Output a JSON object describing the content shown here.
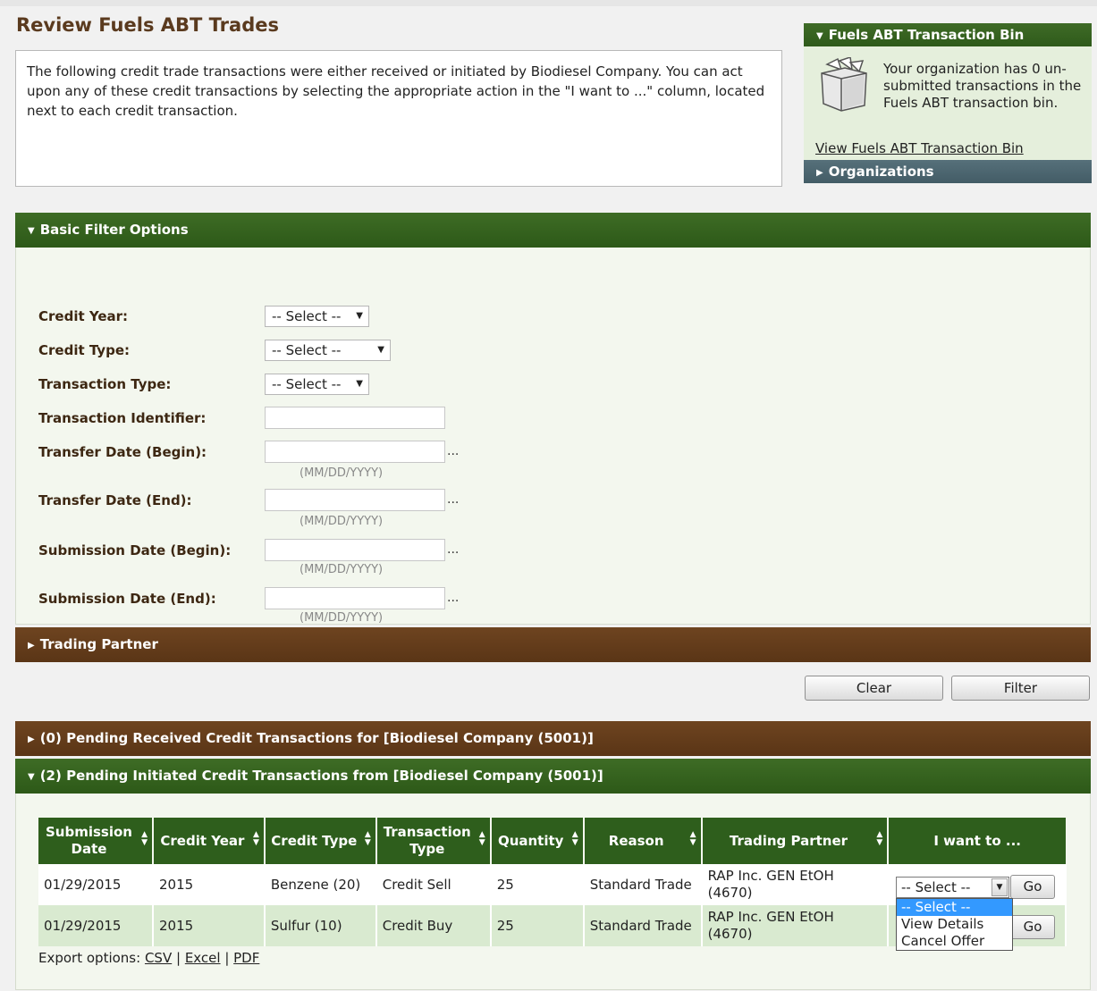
{
  "page": {
    "title": "Review Fuels ABT Trades",
    "intro": "The following credit trade transactions were either received or initiated by Biodiesel Company. You can act upon any of these credit transactions by selecting the appropriate action in the \"I want to ...\" column, located next to each credit transaction."
  },
  "sidebar": {
    "bin_title": "Fuels ABT Transaction Bin",
    "bin_message": "Your organization has 0 un-submitted transactions in the Fuels ABT transaction bin.",
    "bin_link": "View Fuels ABT Transaction Bin",
    "organizations_title": "Organizations"
  },
  "filters": {
    "title": "Basic Filter Options",
    "credit_year_label": "Credit Year:",
    "credit_year_value": "-- Select --",
    "credit_type_label": "Credit Type:",
    "credit_type_value": "-- Select --",
    "transaction_type_label": "Transaction Type:",
    "transaction_type_value": "-- Select --",
    "transaction_identifier_label": "Transaction Identifier:",
    "transfer_begin_label": "Transfer Date (Begin):",
    "transfer_end_label": "Transfer Date (End):",
    "submission_begin_label": "Submission Date (Begin):",
    "submission_end_label": "Submission Date (End):",
    "date_hint": "(MM/DD/YYYY)",
    "picker": "..."
  },
  "trading_partner_title": "Trading Partner",
  "buttons": {
    "clear": "Clear",
    "filter": "Filter",
    "go": "Go"
  },
  "received": {
    "title": "(0) Pending Received Credit Transactions for [Biodiesel Company (5001)]"
  },
  "initiated": {
    "title": "(2) Pending Initiated Credit Transactions from [Biodiesel Company (5001)]",
    "columns": [
      "Submission Date",
      "Credit Year",
      "Credit Type",
      "Transaction Type",
      "Quantity",
      "Reason",
      "Trading Partner",
      "I want to ..."
    ],
    "rows": [
      {
        "submission_date": "01/29/2015",
        "credit_year": "2015",
        "credit_type": "Benzene (20)",
        "transaction_type": "Credit Sell",
        "quantity": "25",
        "reason": "Standard Trade",
        "trading_partner": "RAP Inc. GEN EtOH (4670)",
        "action": "-- Select --"
      },
      {
        "submission_date": "01/29/2015",
        "credit_year": "2015",
        "credit_type": "Sulfur (10)",
        "transaction_type": "Credit Buy",
        "quantity": "25",
        "reason": "Standard Trade",
        "trading_partner": "RAP Inc. GEN EtOH (4670)",
        "action": "-- Select --"
      }
    ],
    "action_options": [
      "-- Select --",
      "View Details",
      "Cancel Offer"
    ]
  },
  "export": {
    "label": "Export options:",
    "csv": "CSV",
    "excel": "Excel",
    "pdf": "PDF"
  },
  "icons": {
    "bin": "transaction-bin-icon",
    "expanded": "triangle-down-icon",
    "collapsed": "triangle-right-icon",
    "sort": "sort-arrows-icon",
    "dropdown": "chevron-down-icon"
  },
  "colors": {
    "green_header": "#2e5a1a",
    "brown_header": "#5a3516",
    "blue_header": "#435c66",
    "title": "#5a3a1e",
    "row_alt": "#d9ead0",
    "selection": "#3399ff"
  }
}
